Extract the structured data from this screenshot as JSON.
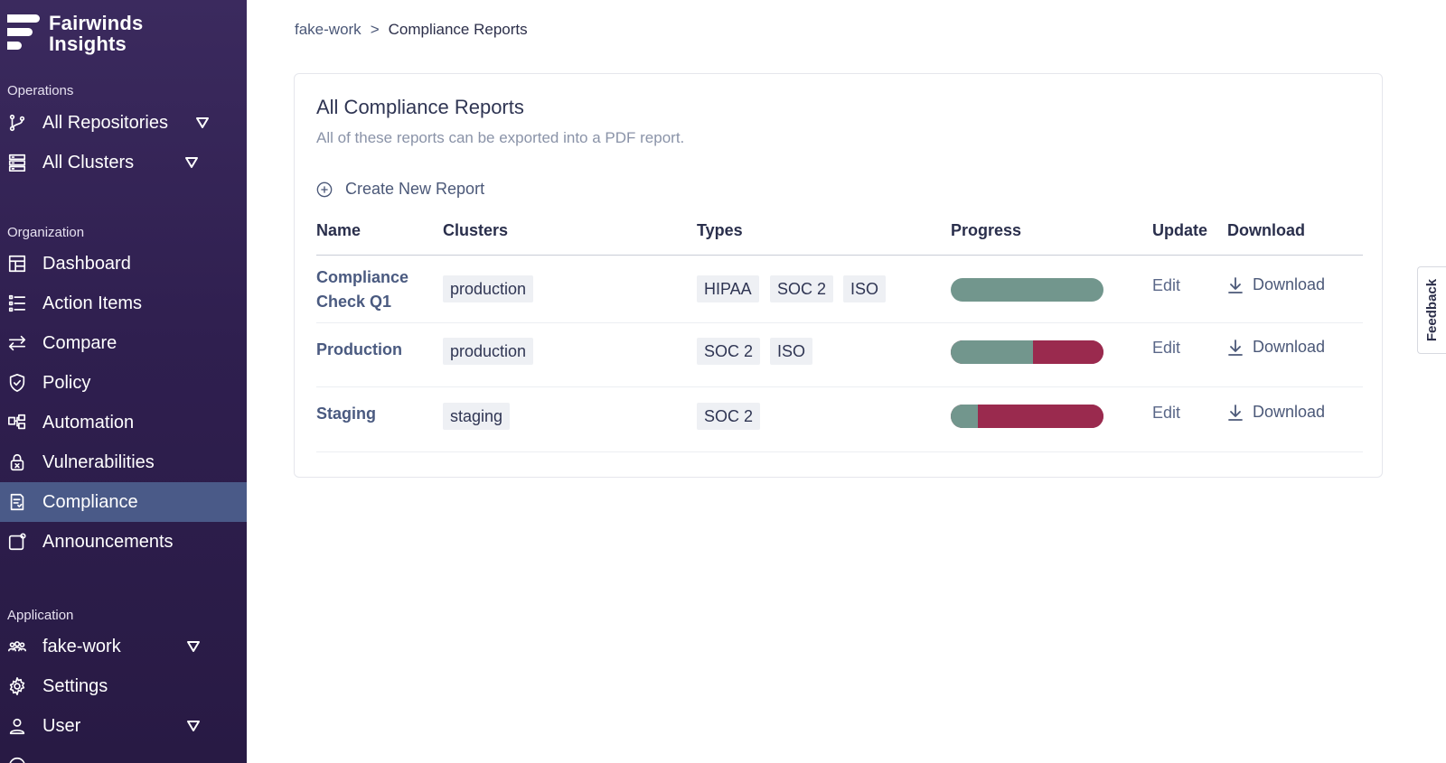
{
  "brand": {
    "line1": "Fairwinds",
    "line2": "Insights"
  },
  "sidebar": {
    "sections": {
      "operations": "Operations",
      "organization": "Organization",
      "application": "Application"
    },
    "operations_items": [
      {
        "label": "All Repositories",
        "icon": "git-branch-icon"
      },
      {
        "label": "All Clusters",
        "icon": "server-icon"
      }
    ],
    "organization_items": [
      {
        "label": "Dashboard",
        "icon": "dashboard-icon"
      },
      {
        "label": "Action Items",
        "icon": "list-icon"
      },
      {
        "label": "Compare",
        "icon": "compare-arrows-icon"
      },
      {
        "label": "Policy",
        "icon": "shield-icon"
      },
      {
        "label": "Automation",
        "icon": "automation-icon"
      },
      {
        "label": "Vulnerabilities",
        "icon": "lock-icon"
      },
      {
        "label": "Compliance",
        "icon": "document-icon",
        "active": true
      },
      {
        "label": "Announcements",
        "icon": "announcement-icon"
      }
    ],
    "application_items": [
      {
        "label": "fake-work",
        "icon": "team-icon"
      },
      {
        "label": "Settings",
        "icon": "gear-icon"
      },
      {
        "label": "User",
        "icon": "user-icon"
      }
    ]
  },
  "breadcrumb": {
    "parent": "fake-work",
    "separator": ">",
    "current": "Compliance Reports"
  },
  "card": {
    "title": "All Compliance Reports",
    "subtitle": "All of these reports can be exported into a PDF report.",
    "create_label": "Create New Report"
  },
  "table": {
    "headers": [
      "Name",
      "Clusters",
      "Types",
      "Progress",
      "Update",
      "Download"
    ],
    "rows": [
      {
        "name_line1": "Compliance",
        "name_line2": "Check Q1",
        "cluster": "production",
        "types": [
          "HIPAA",
          "SOC 2",
          "ISO"
        ],
        "progress_pass_fraction": 1.0,
        "edit": "Edit",
        "download": "Download"
      },
      {
        "name_line1": "Production",
        "name_line2": "",
        "cluster": "production",
        "types": [
          "SOC 2",
          "ISO"
        ],
        "progress_pass_fraction": 0.54,
        "edit": "Edit",
        "download": "Download"
      },
      {
        "name_line1": "Staging",
        "name_line2": "",
        "cluster": "staging",
        "types": [
          "SOC 2"
        ],
        "progress_pass_fraction": 0.18,
        "edit": "Edit",
        "download": "Download"
      }
    ]
  },
  "colors": {
    "progress_pass": "#72968d",
    "progress_fail": "#9a2a4e",
    "sidebar_active": "#4a5a88"
  },
  "feedback_label": "Feedback"
}
